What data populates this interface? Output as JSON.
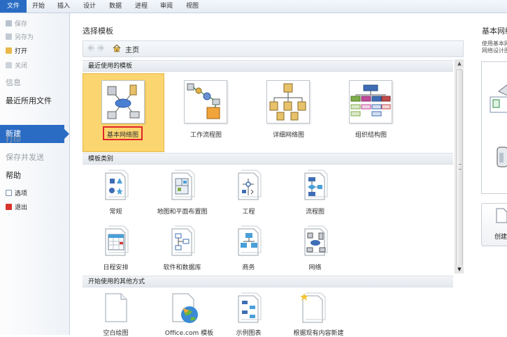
{
  "ribbon": {
    "tabs": [
      "文件",
      "开始",
      "插入",
      "设计",
      "数据",
      "进程",
      "审阅",
      "视图"
    ]
  },
  "backstage": {
    "items": [
      {
        "label": "保存",
        "icon": "save-icon",
        "disabled": true
      },
      {
        "label": "另存为",
        "icon": "save-as-icon",
        "disabled": true
      },
      {
        "label": "打开",
        "icon": "open-folder-icon",
        "disabled": false
      },
      {
        "label": "关闭",
        "icon": "close-doc-icon",
        "disabled": true
      }
    ],
    "info": "信息",
    "recent": "最近所用文件",
    "new": "新建",
    "print": "打印",
    "save_send": "保存并发送",
    "help": "帮助",
    "options": "选项",
    "exit": "退出"
  },
  "main": {
    "title": "选择模板",
    "nav": {
      "home": "主页",
      "back": "←",
      "forward": "→"
    },
    "sections": {
      "recent": "最近使用的模板",
      "categories": "模板类别",
      "other": "开始使用的其他方式"
    },
    "recent_templates": [
      "基本网络图",
      "工作流程图",
      "详细网络图",
      "组织结构图"
    ],
    "categories": [
      "常规",
      "地图和平面布置图",
      "工程",
      "流程图",
      "日程安排",
      "软件和数据库",
      "商务",
      "网络"
    ],
    "other": [
      "空白绘图",
      "Office.com 模板",
      "示例图表",
      "根据现有内容新建"
    ]
  },
  "preview": {
    "title": "基本网络图",
    "desc_line1": "使用基本网",
    "desc_line2": "网络设计图",
    "create_label": "创建"
  },
  "colors": {
    "accent": "#2a6cc4",
    "selected": "#fbd56f",
    "highlight_box": "#e0242a"
  }
}
